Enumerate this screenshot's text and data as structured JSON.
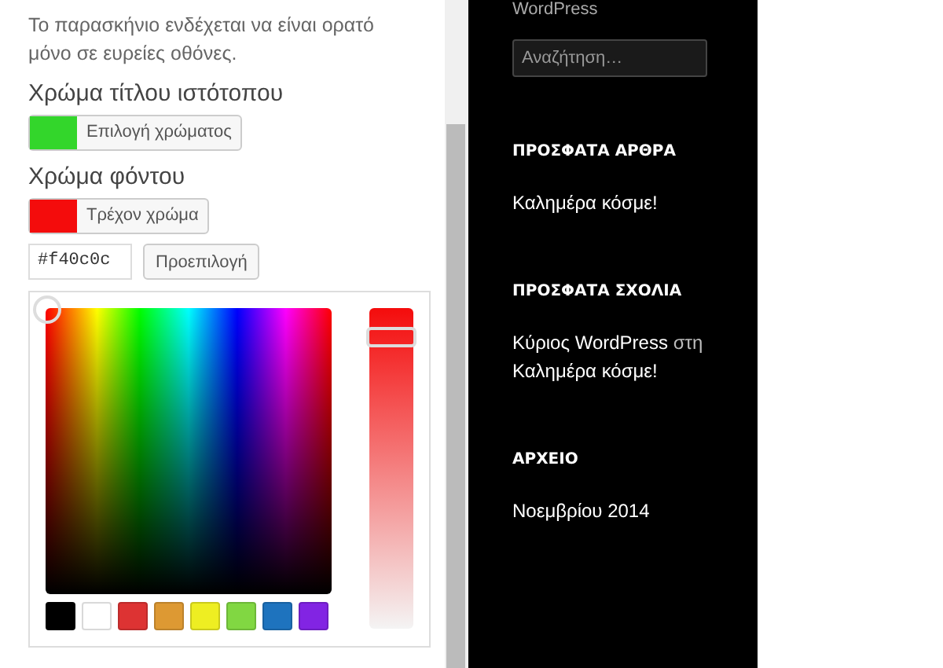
{
  "customizer": {
    "description": "Το παρασκήνιο ενδέχεται να είναι ορατό μόνο σε ευρείες οθόνες.",
    "controls": [
      {
        "heading": "Χρώμα τίτλου ιστότοπου",
        "color": "#33d62b",
        "button": "Επιλογή χρώματος"
      },
      {
        "heading": "Χρώμα φόντου",
        "color": "#f40c0c",
        "button": "Τρέχον χρώμα"
      }
    ],
    "hex_value": "#f40c0c",
    "default_button": "Προεπιλογή",
    "picker": {
      "level": 0.97,
      "palette": [
        {
          "color": "#000000"
        },
        {
          "color": "#ffffff"
        },
        {
          "color": "#dd3333"
        },
        {
          "color": "#dd9933"
        },
        {
          "color": "#eeee22"
        },
        {
          "color": "#81d742"
        },
        {
          "color": "#1e73be"
        },
        {
          "color": "#8224e3"
        }
      ]
    }
  },
  "sidebar": {
    "top_text": "WordPress",
    "search": {
      "placeholder": "Αναζήτηση…"
    },
    "widgets": [
      {
        "title": "ΠΡΟΣΦΑΤΑ ΑΡΘΡΑ",
        "items": [
          {
            "kind": "link",
            "text": "Καλημέρα κόσμε!"
          }
        ]
      },
      {
        "title": "ΠΡΟΣΦΑΤΑ ΣΧΟΛΙΑ",
        "items": [
          {
            "kind": "comment",
            "author": "Κύριος WordPress",
            "connector": "στη",
            "post": "Καλημέρα κόσμε!"
          }
        ]
      },
      {
        "title": "ΑΡΧΕΙΟ",
        "items": [
          {
            "kind": "link",
            "text": "Νοεμβρίου 2014"
          }
        ]
      }
    ]
  }
}
